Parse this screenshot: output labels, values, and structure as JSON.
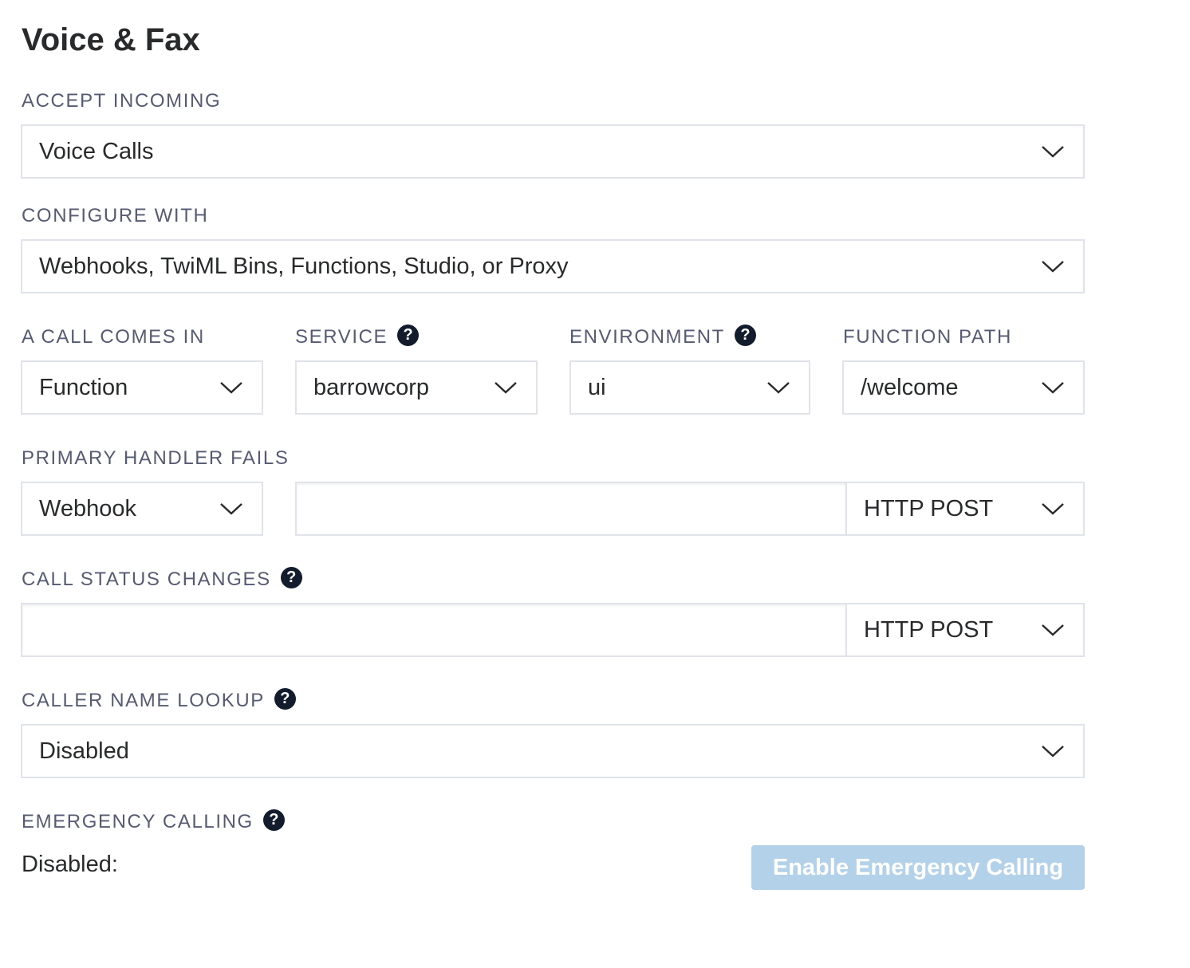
{
  "page": {
    "title": "Voice & Fax"
  },
  "accept_incoming": {
    "label": "ACCEPT INCOMING",
    "value": "Voice Calls"
  },
  "configure_with": {
    "label": "CONFIGURE WITH",
    "value": "Webhooks, TwiML Bins, Functions, Studio, or Proxy"
  },
  "call_comes_in": {
    "label": "A CALL COMES IN",
    "value": "Function"
  },
  "service": {
    "label": "SERVICE",
    "value": "barrowcorp",
    "help_icon": "question-circle-icon"
  },
  "environment": {
    "label": "ENVIRONMENT",
    "value": "ui",
    "help_icon": "question-circle-icon"
  },
  "function_path": {
    "label": "FUNCTION PATH",
    "value": "/welcome"
  },
  "primary_handler_fails": {
    "label": "PRIMARY HANDLER FAILS",
    "type_value": "Webhook",
    "url_value": "",
    "method_value": "HTTP POST"
  },
  "call_status_changes": {
    "label": "CALL STATUS CHANGES",
    "help_icon": "question-circle-icon",
    "url_value": "",
    "method_value": "HTTP POST"
  },
  "caller_name_lookup": {
    "label": "CALLER NAME LOOKUP",
    "help_icon": "question-circle-icon",
    "value": "Disabled"
  },
  "emergency_calling": {
    "label": "EMERGENCY CALLING",
    "help_icon": "question-circle-icon",
    "status_text": "Disabled:",
    "button_label": "Enable Emergency Calling",
    "button_color": "#b3d2e9"
  },
  "colors": {
    "label_text": "#565b73",
    "body_text": "#282a2b",
    "field_border": "#e1e3ea",
    "help_icon_bg": "#121c2d"
  }
}
